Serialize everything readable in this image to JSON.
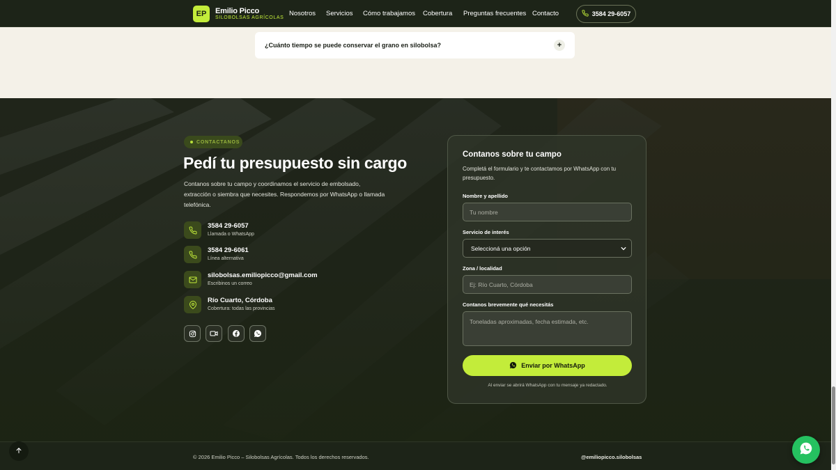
{
  "brand": {
    "initials": "EP",
    "name": "Emilio Picco",
    "tagline": "SILOBOLSAS AGRÍCOLAS",
    "accent_color": "#c3ec3a"
  },
  "nav": {
    "links": [
      "Nosotros",
      "Servicios",
      "Cómo trabajamos",
      "Cobertura",
      "Preguntas frecuentes",
      "Contacto"
    ],
    "phone": "3584 29-6057"
  },
  "faq": {
    "question": "¿Cuánto tiempo se puede conservar el grano en silobolsa?",
    "expand_icon": "plus-icon"
  },
  "contact": {
    "badge": "CONTACTANOS",
    "title": "Pedí tu presupuesto sin cargo",
    "description": "Contanos sobre tu campo y coordinamos el servicio de embolsado, extracción o siembra que necesites. Respondemos por WhatsApp o llamada telefónica.",
    "items": [
      {
        "icon": "phone-icon",
        "main": "3584 29-6057",
        "sub": "Llamada o WhatsApp"
      },
      {
        "icon": "phone-icon",
        "main": "3584 29-6061",
        "sub": "Línea alternativa"
      },
      {
        "icon": "mail-icon",
        "main": "silobolsas.emiliopicco@gmail.com",
        "sub": "Escribinos un correo"
      },
      {
        "icon": "location-pin-icon",
        "main": "Río Cuarto, Córdoba",
        "sub": "Cobertura: todas las provincias"
      }
    ],
    "socials": [
      "instagram-icon",
      "video-icon",
      "facebook-icon",
      "whatsapp-icon"
    ]
  },
  "form": {
    "title": "Contanos sobre tu campo",
    "description": "Completá el formulario y te contactamos por WhatsApp con tu presupuesto.",
    "name_label": "Nombre y apellido",
    "name_placeholder": "Tu nombre",
    "service_label": "Servicio de interés",
    "service_selected": "Seleccioná una opción",
    "zone_label": "Zona / localidad",
    "zone_placeholder": "Ej: Río Cuarto, Córdoba",
    "message_label": "Contanos brevemente qué necesitás",
    "message_placeholder": "Toneladas aproximadas, fecha estimada, etc.",
    "submit_label": "Enviar por WhatsApp",
    "note": "Al enviar se abrirá WhatsApp con tu mensaje ya redactado."
  },
  "footer": {
    "copyright": "© 2026 Emilio Picco – Silobolsas Agrícolas. Todos los derechos reservados.",
    "handle": "@emiliopicco.silobolsas"
  }
}
